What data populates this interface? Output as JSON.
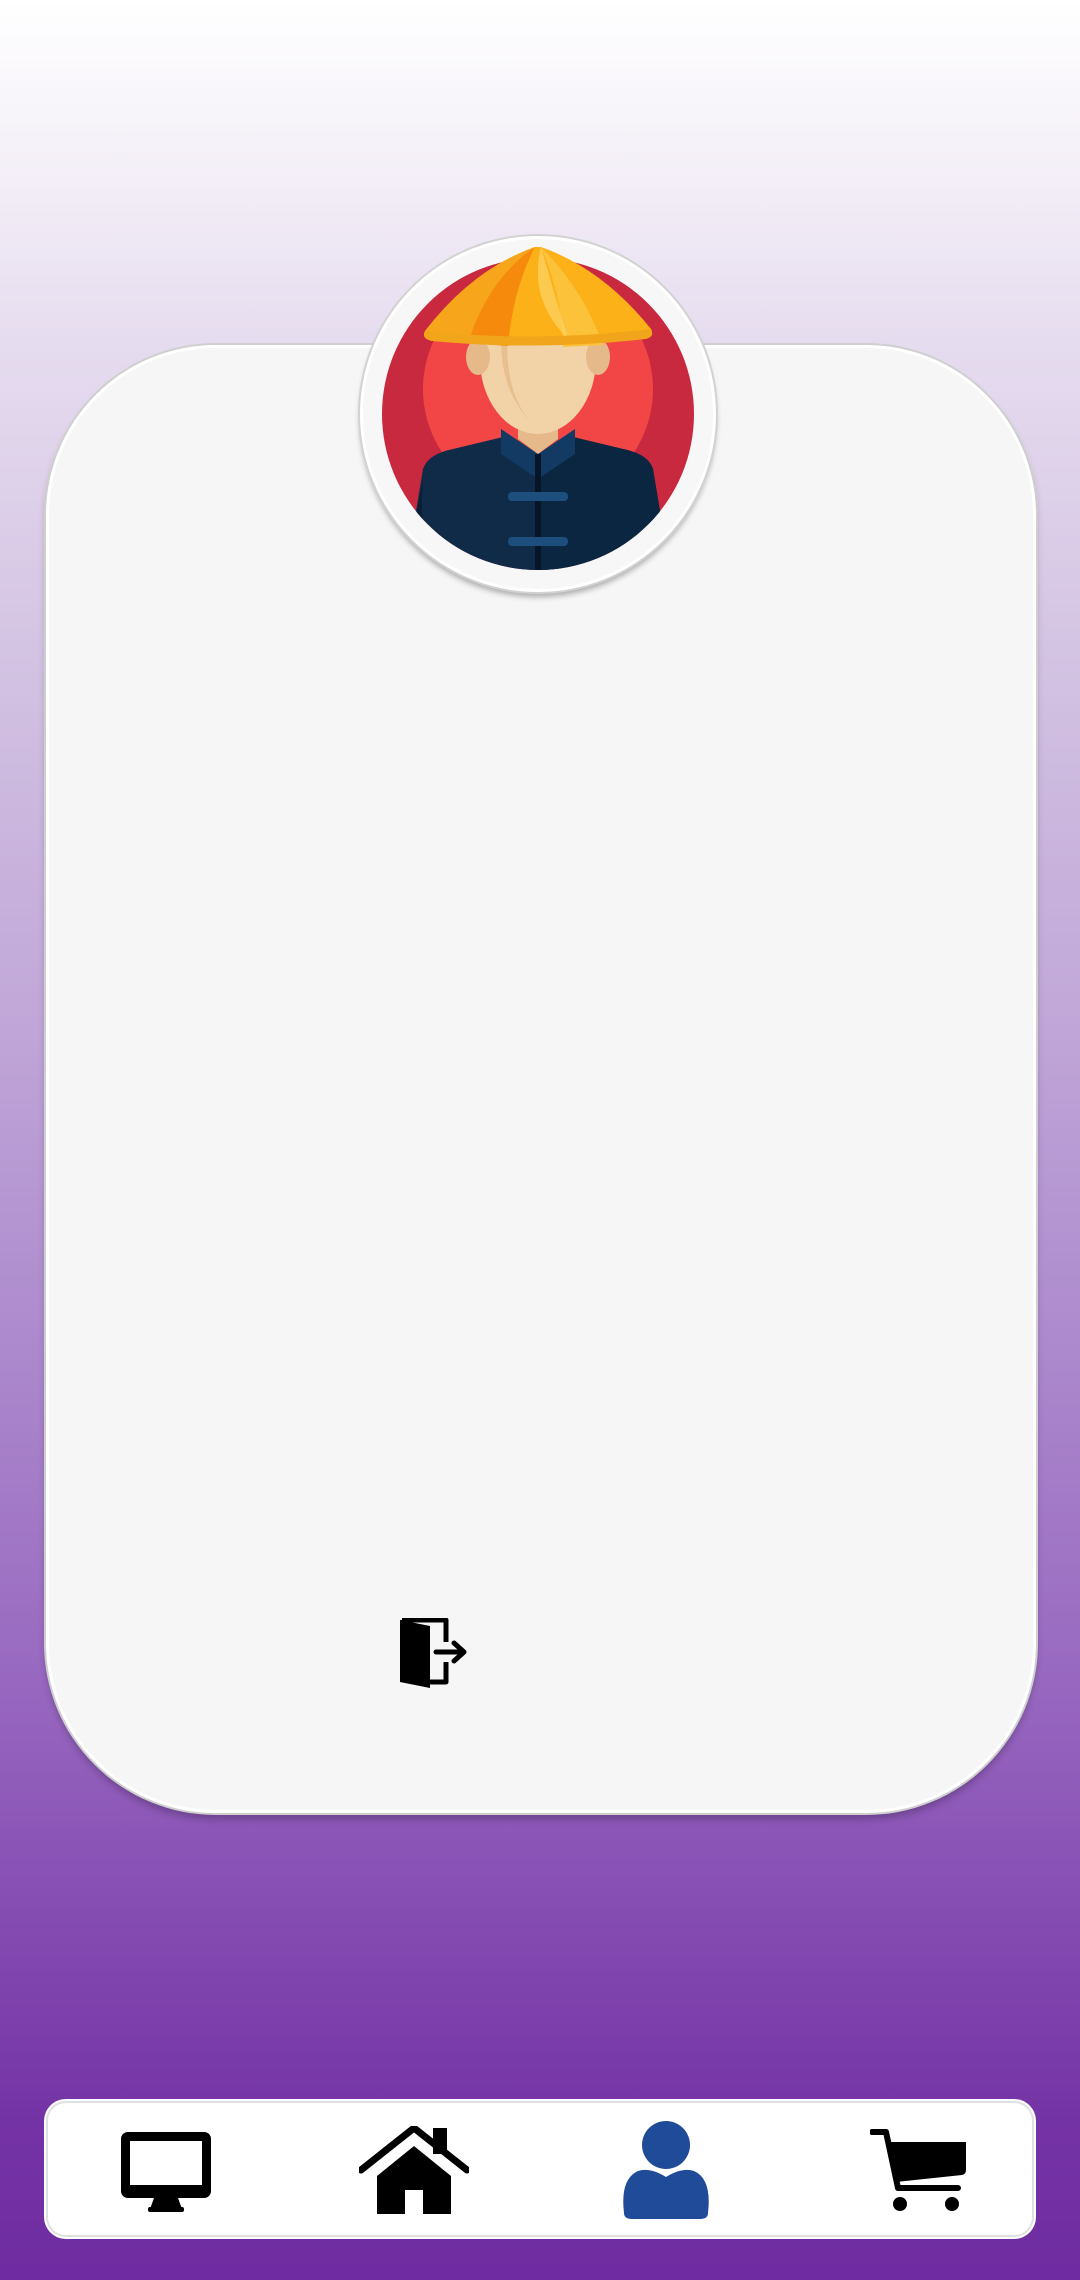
{
  "app": {
    "screen": "profile"
  },
  "profile": {
    "avatar_icon": "avatar-man-conical-hat"
  },
  "actions": {
    "logout_icon": "door-exit-icon"
  },
  "bottom_nav": {
    "items": [
      {
        "icon": "monitor-icon",
        "active": false
      },
      {
        "icon": "home-icon",
        "active": false
      },
      {
        "icon": "user-icon",
        "active": true
      },
      {
        "icon": "cart-icon",
        "active": false
      }
    ],
    "active_color": "#1f4b99",
    "inactive_color": "#000000"
  },
  "colors": {
    "background_top": "#ffffff",
    "background_bottom": "#6f2ca2",
    "card": "#f6f6f6"
  }
}
